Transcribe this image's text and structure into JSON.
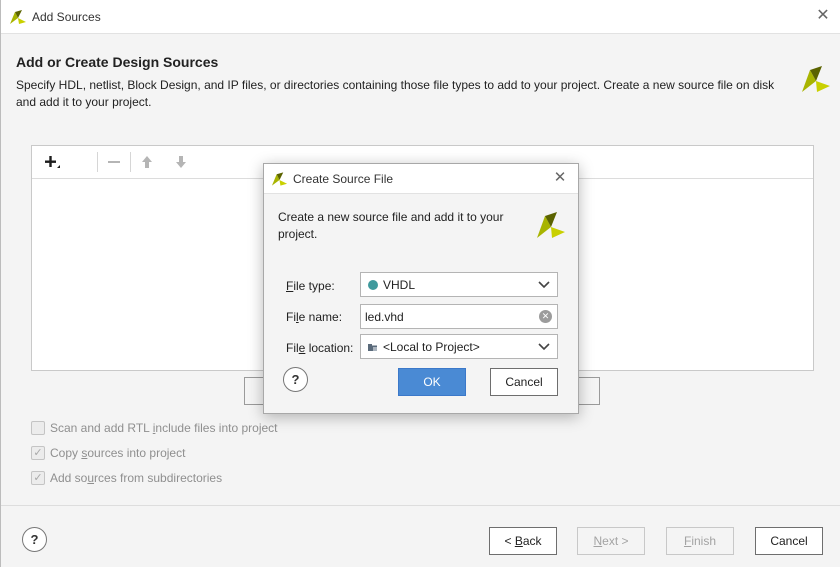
{
  "window": {
    "title": "Add Sources",
    "heading": "Add or Create Design Sources",
    "description": "Specify HDL, netlist, Block Design, and IP files, or directories containing those file types to add to your project. Create a new source file on disk and add it to your project."
  },
  "toolbar": {
    "add_icon": "plus-icon",
    "remove_icon": "minus-icon",
    "up_icon": "arrow-up-icon",
    "down_icon": "arrow-down-icon"
  },
  "options": {
    "scan_rtl": {
      "pre": "Scan and add RTL ",
      "key": "i",
      "post": "nclude files into project",
      "checked": false
    },
    "copy_sources": {
      "pre": "Copy ",
      "key": "s",
      "post": "ources into project",
      "checked": true
    },
    "subdirs": {
      "pre": "Add so",
      "key": "u",
      "post": "rces from subdirectories",
      "checked": true
    }
  },
  "footer": {
    "help": "?",
    "back": {
      "pre": "< ",
      "key": "B",
      "post": "ack"
    },
    "next": {
      "key": "N",
      "post": "ext >"
    },
    "finish": {
      "key": "F",
      "post": "inish"
    },
    "cancel": "Cancel"
  },
  "dialog": {
    "title": "Create Source File",
    "description": "Create a new source file and add it to your project.",
    "file_type": {
      "label_key": "F",
      "label_rest": "ile type:",
      "value": "VHDL"
    },
    "file_name": {
      "label_pre": "Fi",
      "label_key": "l",
      "label_post": "e name:",
      "value": "led.vhd"
    },
    "file_location": {
      "label_pre": "Fil",
      "label_key": "e",
      "label_post": " location:",
      "value": "<Local to Project>"
    },
    "help": "?",
    "ok": "OK",
    "cancel": "Cancel"
  },
  "colors": {
    "primary_button": "#4a8ad4",
    "vhdl_dot": "#3f9a9d",
    "logo_yellow": "#a8b400",
    "logo_dark": "#5b6300"
  }
}
